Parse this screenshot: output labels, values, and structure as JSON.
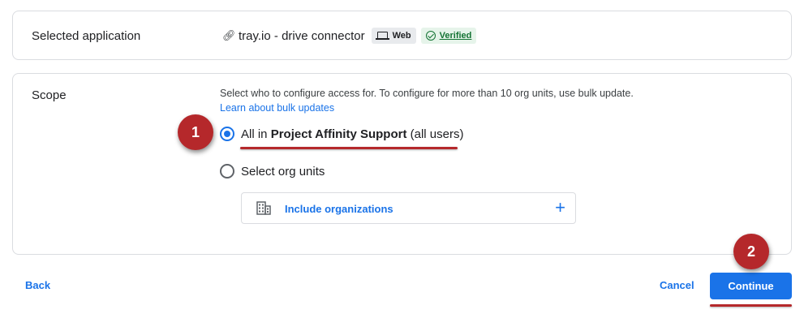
{
  "app_section": {
    "label": "Selected application",
    "app_name": "tray.io - drive connector",
    "platform_chip": "Web",
    "verified_chip": "Verified"
  },
  "scope_section": {
    "label": "Scope",
    "description": "Select who to configure access for. To configure for more than 10 org units, use bulk update.",
    "bulk_link": "Learn about bulk updates",
    "option_all": {
      "prefix": "All in ",
      "org_name": "Project Affinity Support",
      "suffix": " (all users)",
      "selected": true
    },
    "option_org_units": {
      "label": "Select org units",
      "selected": false
    },
    "include_orgs_label": "Include organizations",
    "include_orgs_icon": "+"
  },
  "annotations": {
    "badge_1": "1",
    "badge_2": "2"
  },
  "footer": {
    "back_label": "Back",
    "cancel_label": "Cancel",
    "continue_label": "Continue"
  },
  "colors": {
    "accent": "#1a73e8",
    "verified_green": "#137333",
    "annotation_red": "#b5282b"
  }
}
